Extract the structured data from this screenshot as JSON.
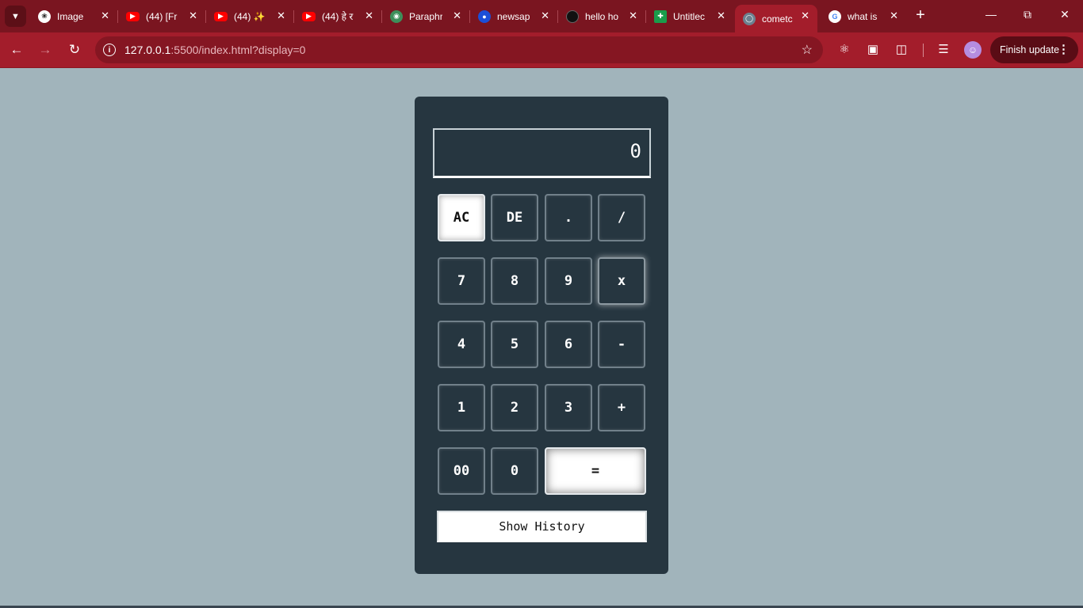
{
  "browser": {
    "tabs": [
      {
        "title": "Image",
        "favicon": "chatgpt-icon"
      },
      {
        "title": "(44) [Fr",
        "favicon": "youtube-icon"
      },
      {
        "title": "(44) ✨",
        "favicon": "youtube-icon"
      },
      {
        "title": "(44) हे र",
        "favicon": "youtube-icon"
      },
      {
        "title": "Paraphr",
        "favicon": "bot-icon"
      },
      {
        "title": "newsap",
        "favicon": "news-icon"
      },
      {
        "title": "hello ho",
        "favicon": "hello-icon"
      },
      {
        "title": "Untitlec",
        "favicon": "sheets-icon"
      },
      {
        "title": "cometc",
        "favicon": "globe-icon",
        "active": true
      },
      {
        "title": "what is",
        "favicon": "google-icon"
      }
    ],
    "close_glyph": "✕",
    "new_tab_glyph": "+",
    "url_host": "127.0.0.1",
    "url_path": ":5500/index.html?display=0",
    "finish_update_label": "Finish update",
    "colors": {
      "tab_strip": "#7a1520",
      "toolbar": "#a31d2b",
      "omnibox": "#851622"
    }
  },
  "calculator": {
    "display_value": "0",
    "keys": {
      "ac": "AC",
      "de": "DE",
      "dot": ".",
      "divide": "/",
      "seven": "7",
      "eight": "8",
      "nine": "9",
      "multiply": "x",
      "four": "4",
      "five": "5",
      "six": "6",
      "minus": "-",
      "one": "1",
      "two": "2",
      "three": "3",
      "plus": "+",
      "double_zero": "00",
      "zero": "0",
      "equals": "="
    },
    "history_button_label": "Show History",
    "colors": {
      "panel": "#263640",
      "page_background": "#a1b4bb",
      "key_border": "#71808a"
    }
  }
}
